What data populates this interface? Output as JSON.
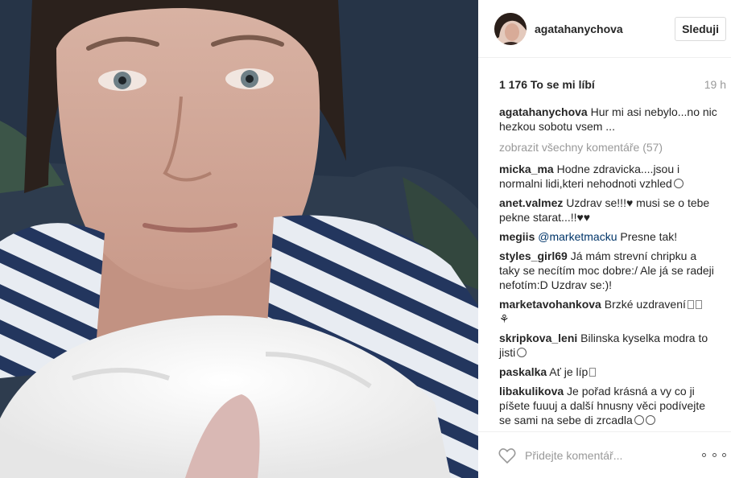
{
  "post": {
    "author": "agatahanychova",
    "follow_label": "Sleduji",
    "likes": "1 176 To se mi líbí",
    "time": "19 h",
    "caption": {
      "user": "agatahanychova",
      "text": "Hur mi asi nebylo...no nic hezkou sobotu vsem ..."
    },
    "show_all": "zobrazit všechny komentáře (57)",
    "comments": [
      {
        "user": "micka_ma",
        "text": "Hodne zdravicka....jsou i normalni lidi,kteri nehodnoti vzhled",
        "trail": "smiley"
      },
      {
        "user": "anet.valmez",
        "text": "Uzdrav se!!!♥ musi se o tebe pekne starat...!!♥♥",
        "trail": ""
      },
      {
        "user": "megiis",
        "mention": "@marketmacku",
        "text": "Presne tak!",
        "trail": ""
      },
      {
        "user": "styles_girl69",
        "text": "Já mám strevní chripku a taky se necítím moc dobre:/ Ale já se radeji nefotím:D Uzdrav se:)!",
        "trail": ""
      },
      {
        "user": "marketavohankova",
        "text": "Brzké uzdravení",
        "trail": "boxes-flower"
      },
      {
        "user": "skripkova_leni",
        "text": "Bilinska kyselka modra to jisti",
        "trail": "smiley"
      },
      {
        "user": "paskalka",
        "text": "Ať je líp",
        "trail": "box"
      },
      {
        "user": "libakulikova",
        "text": "Je pořad krásná a vy co ji píšete fuuuj a další hnusny věci podívejte se sami na sebe di zrcadla",
        "trail": "smiley2"
      }
    ],
    "comment_placeholder": "Přidejte komentář..."
  },
  "icons": {
    "heart": "heart-outline-icon",
    "more": "more-options-icon"
  },
  "colors": {
    "border": "#efefef",
    "muted": "#999999",
    "mention": "#003569"
  }
}
